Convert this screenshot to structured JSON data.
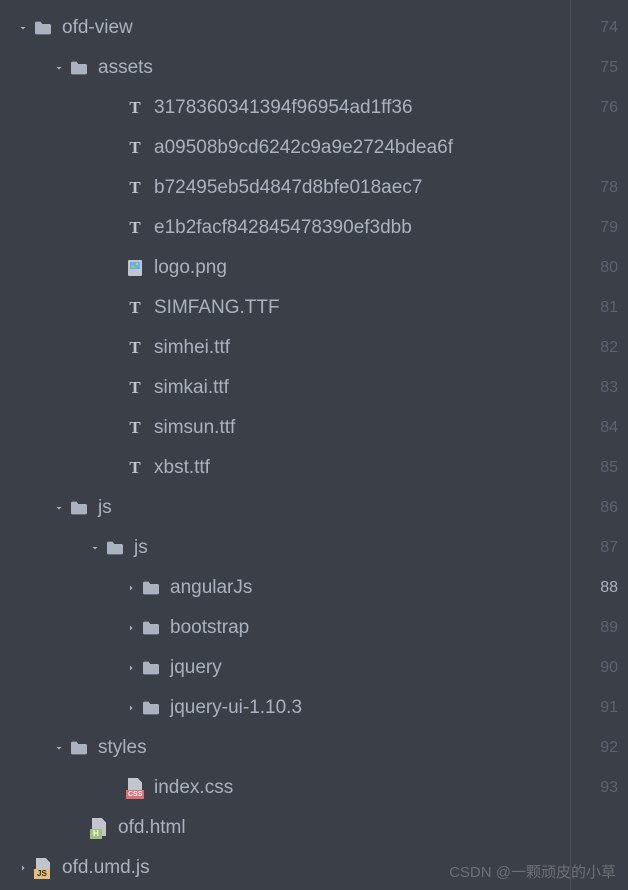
{
  "tree": {
    "root": "ofd-view",
    "assets_folder": "assets",
    "asset_files": [
      "3178360341394f96954ad1ff36",
      "a09508b9cd6242c9a9e2724bdea6f",
      "b72495eb5d4847d8bfe018aec7",
      "e1b2facf842845478390ef3dbb"
    ],
    "logo": "logo.png",
    "font_files": [
      "SIMFANG.TTF",
      "simhei.ttf",
      "simkai.ttf",
      "simsun.ttf",
      "xbst.ttf"
    ],
    "js_folder": "js",
    "js_inner_folder": "js",
    "js_subfolders": [
      "angularJs",
      "bootstrap",
      "jquery",
      "jquery-ui-1.10.3"
    ],
    "styles_folder": "styles",
    "css_file": "index.css",
    "html_file": "ofd.html",
    "umd_file": "ofd.umd.js"
  },
  "line_numbers": [
    "74",
    "75",
    "76",
    "",
    "78",
    "79",
    "80",
    "81",
    "82",
    "83",
    "84",
    "85",
    "86",
    "87",
    "88",
    "89",
    "90",
    "91",
    "92",
    "93",
    ""
  ],
  "active_line_index": 14,
  "watermark": "CSDN @一颗顽皮的小草"
}
